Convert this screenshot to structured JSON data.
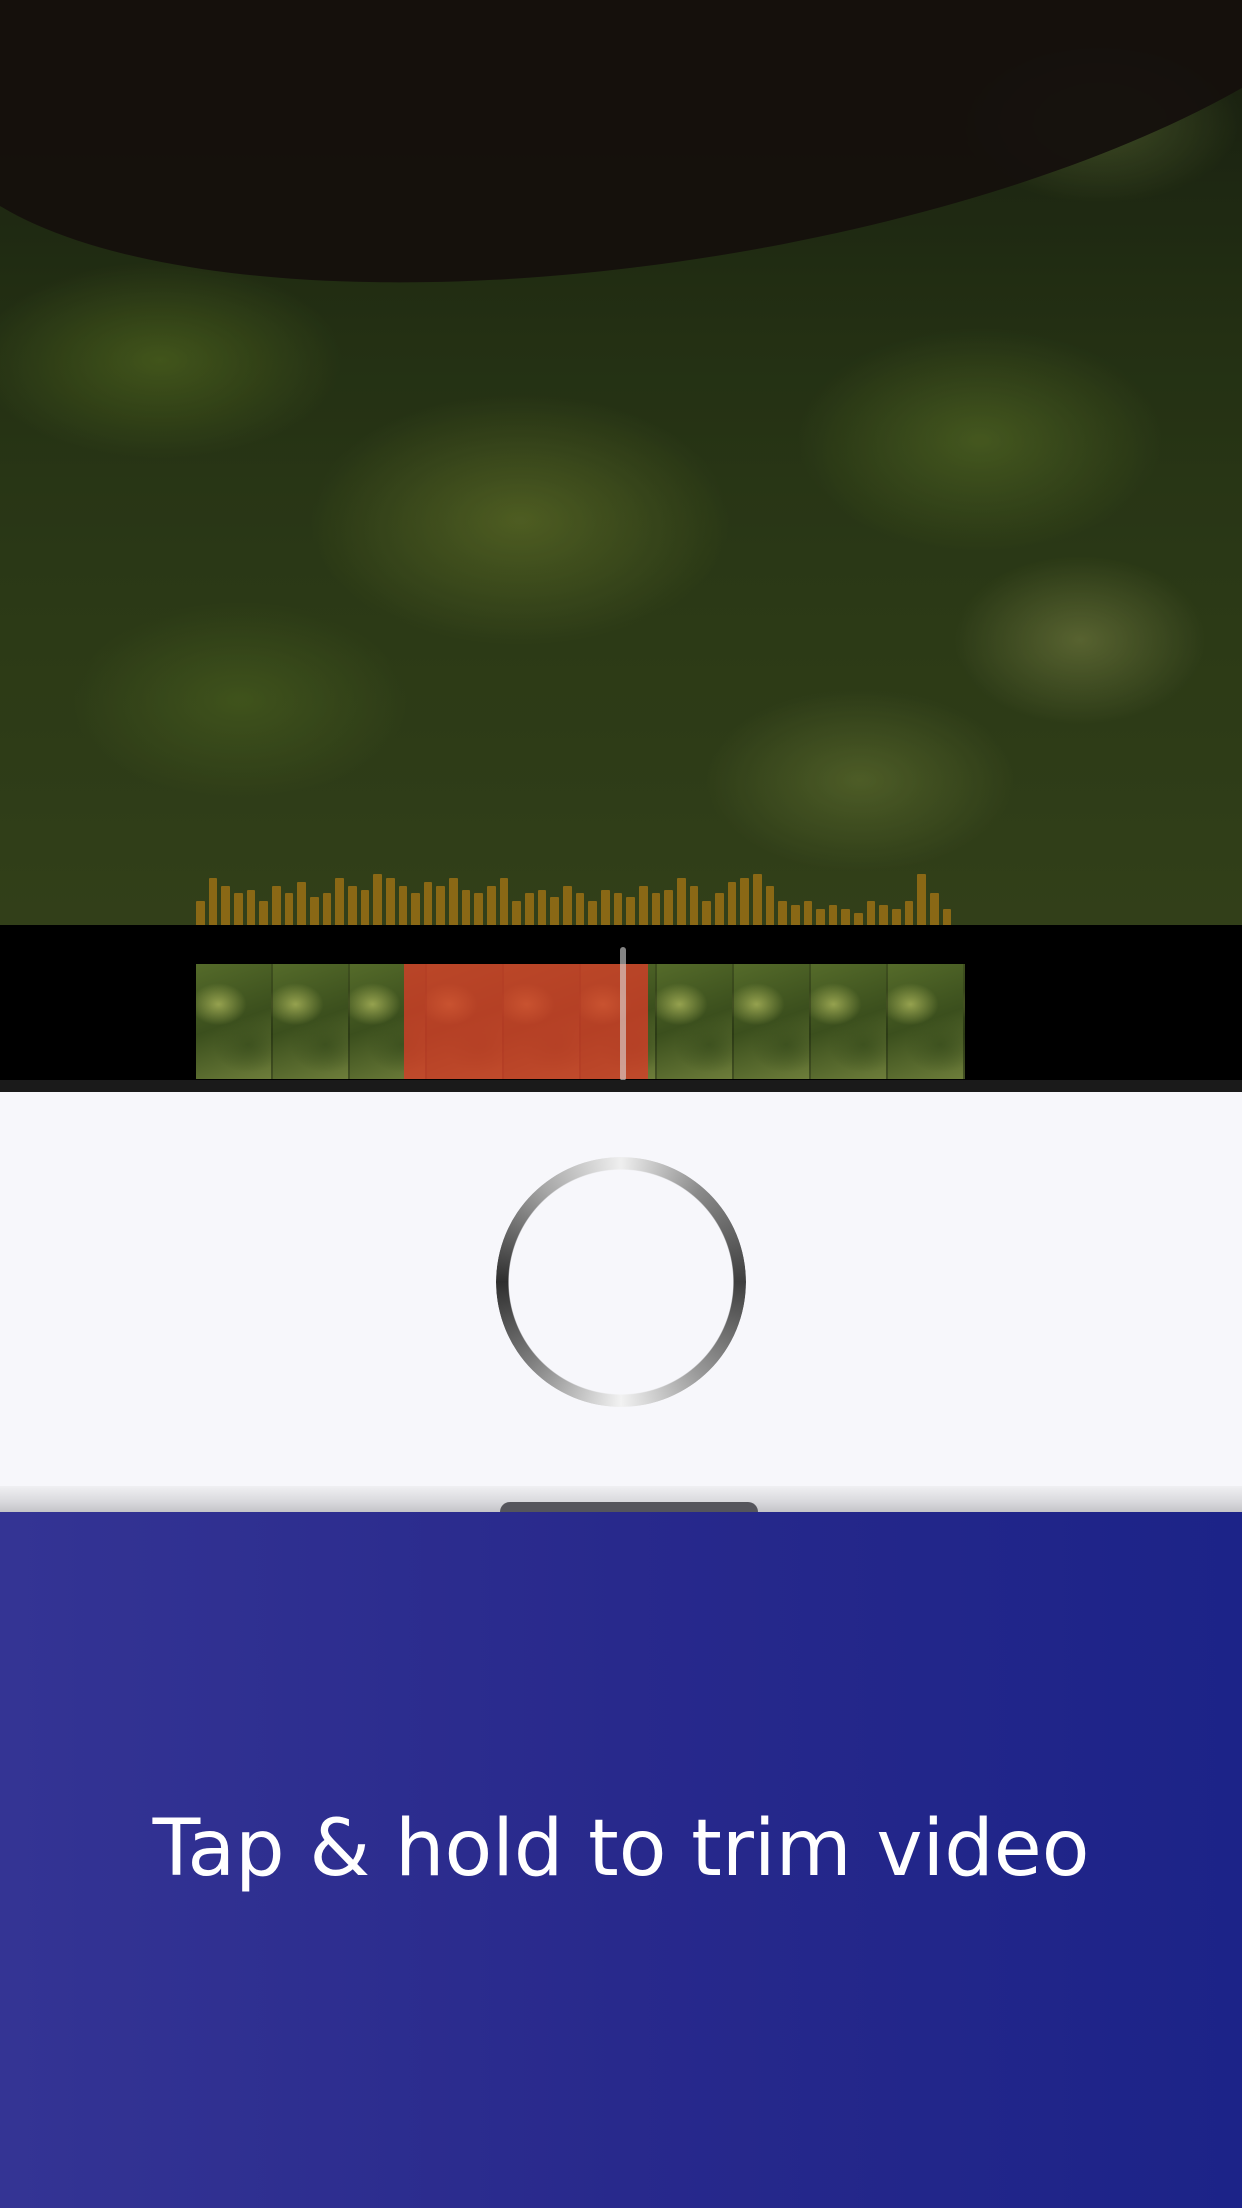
{
  "hint": {
    "text": "Tap & hold to trim video"
  },
  "timeline": {
    "thumbnail_count": 10,
    "waveform_levels": [
      0.6,
      0.9,
      0.8,
      0.7,
      0.75,
      0.6,
      0.8,
      0.7,
      0.85,
      0.65,
      0.7,
      0.9,
      0.8,
      0.75,
      0.95,
      0.9,
      0.8,
      0.7,
      0.85,
      0.8,
      0.9,
      0.75,
      0.7,
      0.8,
      0.9,
      0.6,
      0.7,
      0.75,
      0.65,
      0.8,
      0.7,
      0.6,
      0.75,
      0.7,
      0.65,
      0.8,
      0.7,
      0.75,
      0.9,
      0.8,
      0.6,
      0.7,
      0.85,
      0.9,
      0.95,
      0.8,
      0.6,
      0.55,
      0.6,
      0.5,
      0.55,
      0.5,
      0.45,
      0.6,
      0.55,
      0.5,
      0.6,
      0.95,
      0.7,
      0.5
    ]
  },
  "colors": {
    "trim_selection": "#d73c28",
    "hint_background": "#28298c",
    "record_panel_background": "#f7f7fb",
    "waveform": "#966e14"
  },
  "icons": {
    "record_button": "record-ring-icon"
  }
}
